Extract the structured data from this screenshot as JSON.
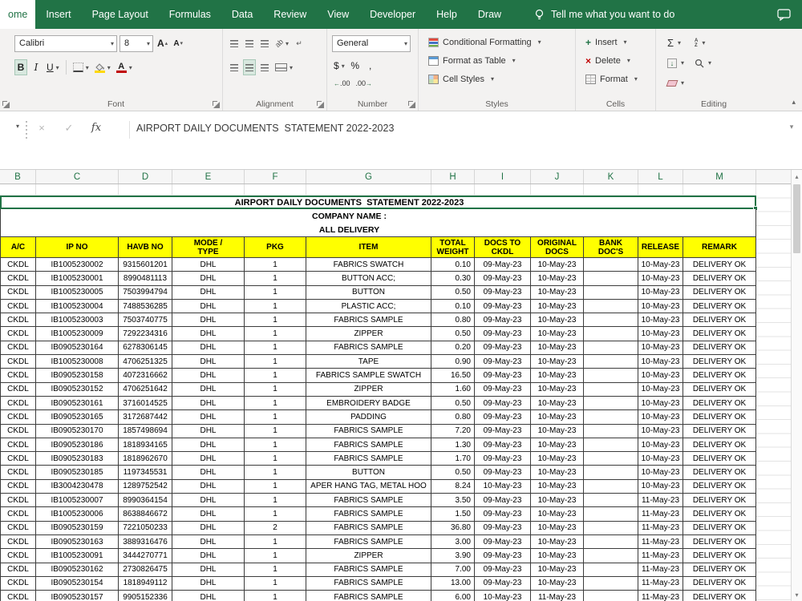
{
  "icons": {
    "dropdown": "▾",
    "collapse": "▴",
    "cancel": "×",
    "check": "✓",
    "fx": "fx",
    "sum": "Σ",
    "scroll_up": "▴",
    "scroll_down": "▾",
    "arrow_right": "→",
    "arrow_left": "←",
    "plus": "+",
    "close": "×",
    "fill_arrow": "↓",
    "wrap_return": "↵",
    "orient": "ab"
  },
  "ribbon": {
    "tabs": [
      "ome",
      "Insert",
      "Page Layout",
      "Formulas",
      "Data",
      "Review",
      "View",
      "Developer",
      "Help",
      "Draw"
    ],
    "tell_me": "Tell me what you want to do",
    "groups": {
      "font": {
        "label": "Font",
        "font_name": "Calibri",
        "font_size": "8",
        "bold": "B",
        "italic": "I",
        "underline": "U"
      },
      "alignment": {
        "label": "Alignment"
      },
      "number": {
        "label": "Number",
        "format": "General",
        "currency": "$",
        "percent": "%",
        "comma": ",",
        "dec": ".00"
      },
      "styles": {
        "label": "Styles",
        "conditional": "Conditional Formatting",
        "format_table": "Format as Table",
        "cell_styles": "Cell Styles"
      },
      "cells": {
        "label": "Cells",
        "insert": "Insert",
        "delete": "Delete",
        "format": "Format"
      },
      "editing": {
        "label": "Editing"
      }
    }
  },
  "formula_bar": {
    "value": "AIRPORT DAILY DOCUMENTS  STATEMENT 2022-2023"
  },
  "sheet": {
    "column_letters": [
      "B",
      "C",
      "D",
      "E",
      "F",
      "G",
      "H",
      "I",
      "J",
      "K",
      "L",
      "M"
    ],
    "title": "AIRPORT DAILY DOCUMENTS  STATEMENT 2022-2023",
    "company_label": "COMPANY NAME :",
    "delivery_label": "ALL DELIVERY",
    "table_headers": [
      "A/C",
      "IP NO",
      "HAVB NO",
      "MODE /\nTYPE",
      "PKG",
      "ITEM",
      "TOTAL\nWEIGHT",
      "DOCS TO\nCKDL",
      "ORIGINAL\nDOCS",
      "BANK\nDOC'S",
      "RELEASE",
      "REMARK"
    ],
    "rows": [
      [
        "CKDL",
        "IB1005230002",
        "9315601201",
        "DHL",
        "1",
        "FABRICS SWATCH",
        "0.10",
        "09-May-23",
        "10-May-23",
        "",
        "10-May-23",
        "DELIVERY OK"
      ],
      [
        "CKDL",
        "IB1005230001",
        "8990481113",
        "DHL",
        "1",
        "BUTTON ACC;",
        "0.30",
        "09-May-23",
        "10-May-23",
        "",
        "10-May-23",
        "DELIVERY OK"
      ],
      [
        "CKDL",
        "IB1005230005",
        "7503994794",
        "DHL",
        "1",
        "BUTTON",
        "0.50",
        "09-May-23",
        "10-May-23",
        "",
        "10-May-23",
        "DELIVERY OK"
      ],
      [
        "CKDL",
        "IB1005230004",
        "7488536285",
        "DHL",
        "1",
        "PLASTIC ACC;",
        "0.10",
        "09-May-23",
        "10-May-23",
        "",
        "10-May-23",
        "DELIVERY OK"
      ],
      [
        "CKDL",
        "IB1005230003",
        "7503740775",
        "DHL",
        "1",
        "FABRICS SAMPLE",
        "0.80",
        "09-May-23",
        "10-May-23",
        "",
        "10-May-23",
        "DELIVERY OK"
      ],
      [
        "CKDL",
        "IB1005230009",
        "7292234316",
        "DHL",
        "1",
        "ZIPPER",
        "0.50",
        "09-May-23",
        "10-May-23",
        "",
        "10-May-23",
        "DELIVERY OK"
      ],
      [
        "CKDL",
        "IB0905230164",
        "6278306145",
        "DHL",
        "1",
        "FABRICS SAMPLE",
        "0.20",
        "09-May-23",
        "10-May-23",
        "",
        "10-May-23",
        "DELIVERY OK"
      ],
      [
        "CKDL",
        "IB1005230008",
        "4706251325",
        "DHL",
        "1",
        "TAPE",
        "0.90",
        "09-May-23",
        "10-May-23",
        "",
        "10-May-23",
        "DELIVERY OK"
      ],
      [
        "CKDL",
        "IB0905230158",
        "4072316662",
        "DHL",
        "1",
        "FABRICS SAMPLE SWATCH",
        "16.50",
        "09-May-23",
        "10-May-23",
        "",
        "10-May-23",
        "DELIVERY OK"
      ],
      [
        "CKDL",
        "IB0905230152",
        "4706251642",
        "DHL",
        "1",
        "ZIPPER",
        "1.60",
        "09-May-23",
        "10-May-23",
        "",
        "10-May-23",
        "DELIVERY OK"
      ],
      [
        "CKDL",
        "IB0905230161",
        "3716014525",
        "DHL",
        "1",
        "EMBROIDERY BADGE",
        "0.50",
        "09-May-23",
        "10-May-23",
        "",
        "10-May-23",
        "DELIVERY OK"
      ],
      [
        "CKDL",
        "IB0905230165",
        "3172687442",
        "DHL",
        "1",
        "PADDING",
        "0.80",
        "09-May-23",
        "10-May-23",
        "",
        "10-May-23",
        "DELIVERY OK"
      ],
      [
        "CKDL",
        "IB0905230170",
        "1857498694",
        "DHL",
        "1",
        "FABRICS SAMPLE",
        "7.20",
        "09-May-23",
        "10-May-23",
        "",
        "10-May-23",
        "DELIVERY OK"
      ],
      [
        "CKDL",
        "IB0905230186",
        "1818934165",
        "DHL",
        "1",
        "FABRICS SAMPLE",
        "1.30",
        "09-May-23",
        "10-May-23",
        "",
        "10-May-23",
        "DELIVERY OK"
      ],
      [
        "CKDL",
        "IB0905230183",
        "1818962670",
        "DHL",
        "1",
        "FABRICS SAMPLE",
        "1.70",
        "09-May-23",
        "10-May-23",
        "",
        "10-May-23",
        "DELIVERY OK"
      ],
      [
        "CKDL",
        "IB0905230185",
        "1197345531",
        "DHL",
        "1",
        "BUTTON",
        "0.50",
        "09-May-23",
        "10-May-23",
        "",
        "10-May-23",
        "DELIVERY OK"
      ],
      [
        "CKDL",
        "IB3004230478",
        "1289752542",
        "DHL",
        "1",
        "APER HANG TAG, METAL HOO",
        "8.24",
        "10-May-23",
        "10-May-23",
        "",
        "10-May-23",
        "DELIVERY OK"
      ],
      [
        "CKDL",
        "IB1005230007",
        "8990364154",
        "DHL",
        "1",
        "FABRICS SAMPLE",
        "3.50",
        "09-May-23",
        "10-May-23",
        "",
        "11-May-23",
        "DELIVERY OK"
      ],
      [
        "CKDL",
        "IB1005230006",
        "8638846672",
        "DHL",
        "1",
        "FABRICS SAMPLE",
        "1.50",
        "09-May-23",
        "10-May-23",
        "",
        "11-May-23",
        "DELIVERY OK"
      ],
      [
        "CKDL",
        "IB0905230159",
        "7221050233",
        "DHL",
        "2",
        "FABRICS SAMPLE",
        "36.80",
        "09-May-23",
        "10-May-23",
        "",
        "11-May-23",
        "DELIVERY OK"
      ],
      [
        "CKDL",
        "IB0905230163",
        "3889316476",
        "DHL",
        "1",
        "FABRICS SAMPLE",
        "3.00",
        "09-May-23",
        "10-May-23",
        "",
        "11-May-23",
        "DELIVERY OK"
      ],
      [
        "CKDL",
        "IB1005230091",
        "3444270771",
        "DHL",
        "1",
        "ZIPPER",
        "3.90",
        "09-May-23",
        "10-May-23",
        "",
        "11-May-23",
        "DELIVERY OK"
      ],
      [
        "CKDL",
        "IB0905230162",
        "2730826475",
        "DHL",
        "1",
        "FABRICS SAMPLE",
        "7.00",
        "09-May-23",
        "10-May-23",
        "",
        "11-May-23",
        "DELIVERY OK"
      ],
      [
        "CKDL",
        "IB0905230154",
        "1818949112",
        "DHL",
        "1",
        "FABRICS SAMPLE",
        "13.00",
        "09-May-23",
        "10-May-23",
        "",
        "11-May-23",
        "DELIVERY OK"
      ],
      [
        "CKDL",
        "IB0905230157",
        "9905152336",
        "DHL",
        "1",
        "FABRICS SAMPLE",
        "6.00",
        "10-May-23",
        "11-May-23",
        "",
        "11-May-23",
        "DELIVERY OK"
      ]
    ]
  }
}
